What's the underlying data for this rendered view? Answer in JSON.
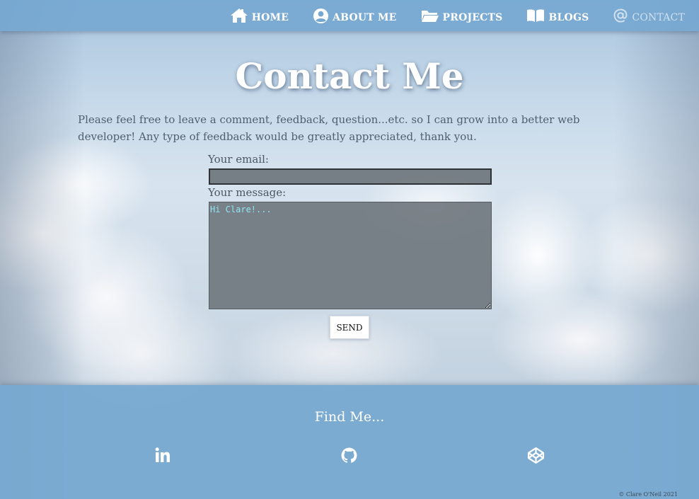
{
  "nav": {
    "items": [
      {
        "label": "HOME",
        "icon": "home-icon"
      },
      {
        "label": "ABOUT ME",
        "icon": "user-circle-icon"
      },
      {
        "label": "PROJECTS",
        "icon": "folder-open-icon"
      },
      {
        "label": "BLOGS",
        "icon": "book-icon"
      },
      {
        "label": "CONTACT",
        "icon": "at-icon",
        "active": true
      }
    ]
  },
  "main": {
    "title": "Contact Me",
    "intro": "Please feel free to leave a comment, feedback, question...etc. so I can grow into a better web developer! Any type of feedback would be greatly appreciated, thank you.",
    "form": {
      "email_label": "Your email:",
      "email_value": "",
      "message_label": "Your message:",
      "message_placeholder": "Hi Clare!...",
      "send_label": "SEND"
    }
  },
  "footer": {
    "heading": "Find Me...",
    "social": [
      {
        "name": "linkedin-icon"
      },
      {
        "name": "github-icon"
      },
      {
        "name": "codepen-icon"
      }
    ],
    "copyright": "© Clare O'Neil 2021"
  },
  "colors": {
    "nav_bg": "#76a8d1",
    "accent_text": "#ffffff",
    "active_nav": "#cfe0ee",
    "input_bg": "#6e767c",
    "input_text": "#8fe6f2"
  }
}
